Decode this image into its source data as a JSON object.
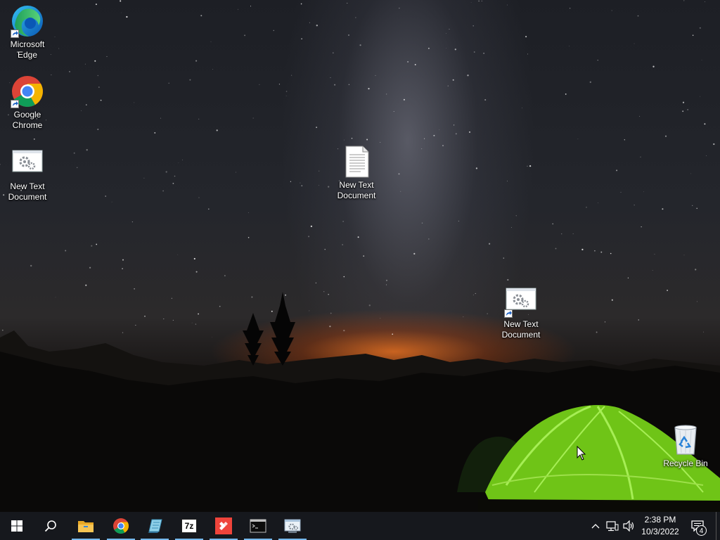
{
  "desktop": {
    "icons": [
      {
        "label": "Microsoft Edge",
        "icon": "edge-icon"
      },
      {
        "label": "Google Chrome",
        "icon": "chrome-icon"
      },
      {
        "label": "New Text Document",
        "icon": "gears-shortcut-icon"
      },
      {
        "label": "New Text Document",
        "icon": "text-document-icon"
      },
      {
        "label": "New Text Document",
        "icon": "gears-shortcut-icon"
      },
      {
        "label": "Recycle Bin",
        "icon": "recycle-bin-icon"
      }
    ]
  },
  "taskbar": {
    "pinned": [
      {
        "name": "start-button",
        "icon": "windows-logo-icon"
      },
      {
        "name": "search-button",
        "icon": "search-icon"
      },
      {
        "name": "file-explorer",
        "icon": "folder-icon",
        "active": true
      },
      {
        "name": "google-chrome",
        "icon": "chrome-icon",
        "active": true
      },
      {
        "name": "notepad-app",
        "icon": "notepad-icon",
        "active": true
      },
      {
        "name": "7zip-app",
        "icon": "7zip-icon",
        "label": "7z",
        "active": true
      },
      {
        "name": "anydesk-app",
        "icon": "anydesk-icon",
        "active": true
      },
      {
        "name": "terminal-app",
        "icon": "terminal-icon",
        "active": true
      },
      {
        "name": "control-panel-app",
        "icon": "settings-window-icon",
        "active": true
      }
    ],
    "tray": {
      "chevron": "chevron-up-icon",
      "network": "network-icon",
      "volume": "volume-icon",
      "time": "2:38 PM",
      "date": "10/3/2022",
      "notifications_count": "4"
    }
  },
  "colors": {
    "taskbar_bg": "#16181d",
    "active_indicator": "#76b9ed",
    "tent": "#7fd41e"
  }
}
